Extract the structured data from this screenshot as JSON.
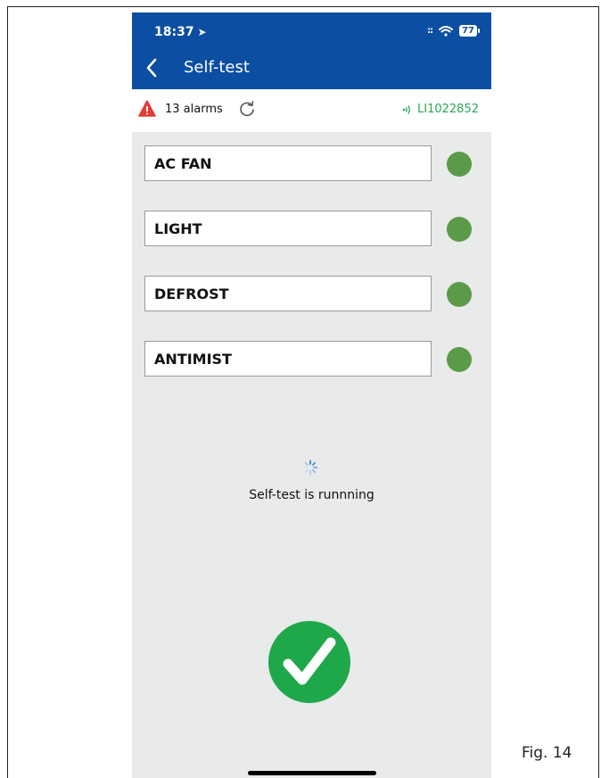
{
  "status_bar": {
    "time": "18:37",
    "signal": "::",
    "battery": "77"
  },
  "header": {
    "title": "Self-test"
  },
  "alarms": {
    "text": "13 alarms"
  },
  "device": {
    "id": "LI1022852"
  },
  "tests": [
    {
      "label": "AC FAN",
      "status_color": "#5b9a48"
    },
    {
      "label": "LIGHT",
      "status_color": "#5b9a48"
    },
    {
      "label": "DEFROST",
      "status_color": "#5b9a48"
    },
    {
      "label": "ANTIMIST",
      "status_color": "#5b9a48"
    }
  ],
  "progress": {
    "text": "Self-test is runnning"
  },
  "caption": "Fig. 14",
  "colors": {
    "header": "#0b4ea2",
    "ok": "#5b9a48",
    "check": "#1ea84a",
    "device": "#2aa653",
    "alarm": "#e53935"
  }
}
